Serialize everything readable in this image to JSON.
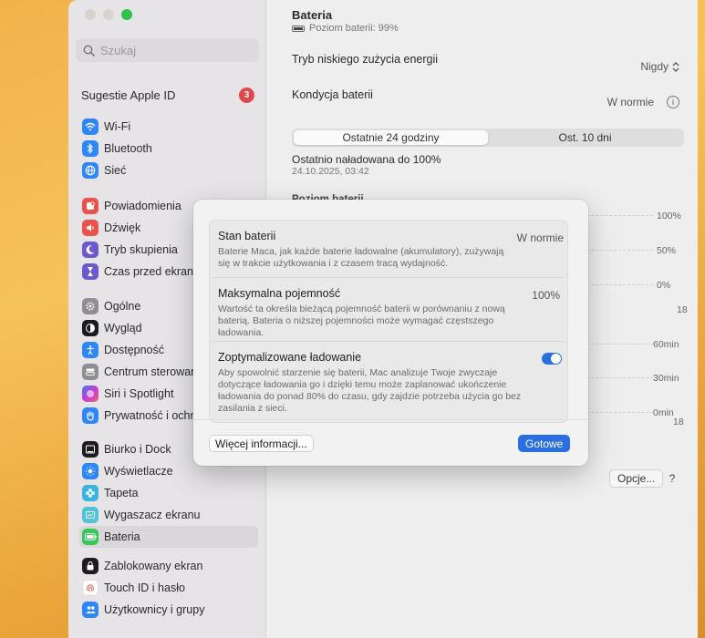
{
  "search": {
    "placeholder": "Szukaj"
  },
  "apple_id": {
    "label": "Sugestie Apple ID",
    "badge": "3"
  },
  "sidebar": {
    "groups": [
      [
        {
          "label": "Wi-Fi",
          "icon": "wifi-icon",
          "color": "#2f86f6"
        },
        {
          "label": "Bluetooth",
          "icon": "bluetooth-icon",
          "color": "#2f86f6"
        },
        {
          "label": "Sieć",
          "icon": "globe-icon",
          "color": "#2f86f6"
        }
      ],
      [
        {
          "label": "Powiadomienia",
          "icon": "bell-icon",
          "color": "#e8524a"
        },
        {
          "label": "Dźwięk",
          "icon": "speaker-icon",
          "color": "#e8524a"
        },
        {
          "label": "Tryb skupienia",
          "icon": "moon-icon",
          "color": "#6a5acd"
        },
        {
          "label": "Czas przed ekranem",
          "icon": "hourglass-icon",
          "color": "#6a5acd"
        }
      ],
      [
        {
          "label": "Ogólne",
          "icon": "gear-icon",
          "color": "#8e8e93"
        },
        {
          "label": "Wygląd",
          "icon": "appearance-icon",
          "color": "#1c1c1e"
        },
        {
          "label": "Dostępność",
          "icon": "accessibility-icon",
          "color": "#2f86f6"
        },
        {
          "label": "Centrum sterowania",
          "icon": "control-center-icon",
          "color": "#8e8e93"
        },
        {
          "label": "Siri i Spotlight",
          "icon": "siri-icon",
          "color": "#b04ad8"
        },
        {
          "label": "Prywatność i ochrona",
          "icon": "hand-icon",
          "color": "#2f86f6"
        }
      ],
      [
        {
          "label": "Biurko i Dock",
          "icon": "dock-icon",
          "color": "#1c1c1e"
        },
        {
          "label": "Wyświetlacze",
          "icon": "sun-icon",
          "color": "#2f86f6"
        },
        {
          "label": "Tapeta",
          "icon": "flower-icon",
          "color": "#3bb4e0"
        },
        {
          "label": "Wygaszacz ekranu",
          "icon": "screensaver-icon",
          "color": "#4fc3d8"
        },
        {
          "label": "Bateria",
          "icon": "battery-icon",
          "color": "#34c759"
        }
      ],
      [
        {
          "label": "Zablokowany ekran",
          "icon": "lock-icon",
          "color": "#1c1c1e"
        },
        {
          "label": "Touch ID i hasło",
          "icon": "fingerprint-icon",
          "color": "#e8524a"
        },
        {
          "label": "Użytkownicy i grupy",
          "icon": "users-icon",
          "color": "#2f86f6"
        }
      ]
    ],
    "active": "Bateria"
  },
  "content": {
    "title": "Bateria",
    "battery_level": "Poziom baterii: 99%",
    "low_power_label": "Tryb niskiego zużycia energii",
    "low_power_value": "Nigdy",
    "health_label": "Kondycja baterii",
    "health_value": "W normie",
    "tabs": [
      "Ostatnie 24 godziny",
      "Ost. 10 dni"
    ],
    "last_charged_label": "Ostatnio naładowana do 100%",
    "last_charged_date": "24.10.2025, 03:42",
    "chart_heading": "Poziom baterii",
    "level_axis": [
      "100%",
      "50%",
      "0%"
    ],
    "level_x_tick": "18",
    "usage_axis": [
      "60min",
      "30min",
      "0min"
    ],
    "usage_x_tick": "18",
    "options_button": "Opcje...",
    "help_button": "?"
  },
  "modal": {
    "rows": [
      {
        "title": "Stan baterii",
        "value": "W normie",
        "desc": "Baterie Maca, jak każde baterie ładowalne (akumulatory), zużywają się w trakcie użytkowania i z czasem tracą wydajność."
      },
      {
        "title": "Maksymalna pojemność",
        "value": "100%",
        "desc": "Wartość ta określa bieżącą pojemność baterii w porównaniu z nową baterią. Bateria o niższej pojemności może wymagać częstszego ładowania."
      }
    ],
    "optimized": {
      "title": "Zoptymalizowane ładowanie",
      "desc": "Aby spowolnić starzenie się baterii, Mac analizuje Twoje zwyczaje dotyczące ładowania go i dzięki temu może zaplanować ukończenie ładowania do ponad 80% do czasu, gdy zajdzie potrzeba użycia go bez zasilania z sieci.",
      "enabled": true
    },
    "more_button": "Więcej informacji...",
    "done_button": "Gotowe"
  }
}
